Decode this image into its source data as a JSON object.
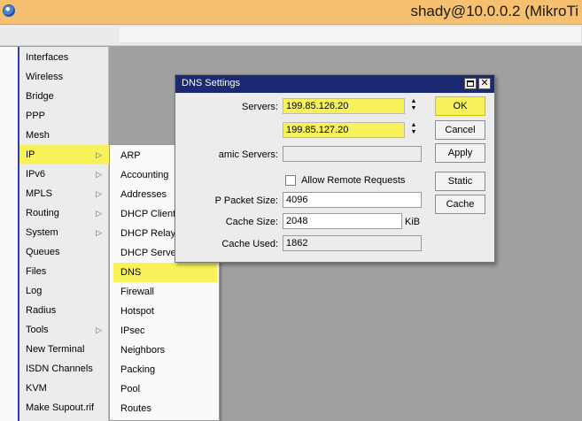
{
  "window": {
    "title": "shady@10.0.0.2 (MikroTi"
  },
  "menu": {
    "items": [
      {
        "label": "Interfaces",
        "arrow": ""
      },
      {
        "label": "Wireless",
        "arrow": ""
      },
      {
        "label": "Bridge",
        "arrow": ""
      },
      {
        "label": "PPP",
        "arrow": ""
      },
      {
        "label": "Mesh",
        "arrow": ""
      },
      {
        "label": "IP",
        "arrow": "▷"
      },
      {
        "label": "IPv6",
        "arrow": "▷"
      },
      {
        "label": "MPLS",
        "arrow": "▷"
      },
      {
        "label": "Routing",
        "arrow": "▷"
      },
      {
        "label": "System",
        "arrow": "▷"
      },
      {
        "label": "Queues",
        "arrow": ""
      },
      {
        "label": "Files",
        "arrow": ""
      },
      {
        "label": "Log",
        "arrow": ""
      },
      {
        "label": "Radius",
        "arrow": ""
      },
      {
        "label": "Tools",
        "arrow": "▷"
      },
      {
        "label": "New Terminal",
        "arrow": ""
      },
      {
        "label": "ISDN Channels",
        "arrow": ""
      },
      {
        "label": "KVM",
        "arrow": ""
      },
      {
        "label": "Make Supout.rif",
        "arrow": ""
      }
    ]
  },
  "submenu": {
    "items": [
      "ARP",
      "Accounting",
      "Addresses",
      "DHCP Client",
      "DHCP Relay",
      "DHCP Server",
      "DNS",
      "Firewall",
      "Hotspot",
      "IPsec",
      "Neighbors",
      "Packing",
      "Pool",
      "Routes"
    ]
  },
  "dialog": {
    "title": "DNS Settings",
    "servers_label": "Servers:",
    "server1": "199.85.126.20",
    "server2": "199.85.127.20",
    "dynamic_servers_label": "amic Servers:",
    "dynamic_servers_value": "",
    "allow_remote_label": "Allow Remote Requests",
    "allow_remote_checked": false,
    "packet_size_label": "P Packet Size:",
    "packet_size": "4096",
    "cache_size_label": "Cache Size:",
    "cache_size": "2048",
    "cache_size_unit": "KiB",
    "cache_used_label": "Cache Used:",
    "cache_used": "1862",
    "buttons": {
      "ok": "OK",
      "cancel": "Cancel",
      "apply": "Apply",
      "static": "Static",
      "cache": "Cache"
    }
  },
  "colors": {
    "highlight": "#f7f25a",
    "dialog_titlebar": "#1b2a70",
    "window_titlebar": "#f5c06f",
    "sidebar_bar": "#2f3ea8"
  }
}
